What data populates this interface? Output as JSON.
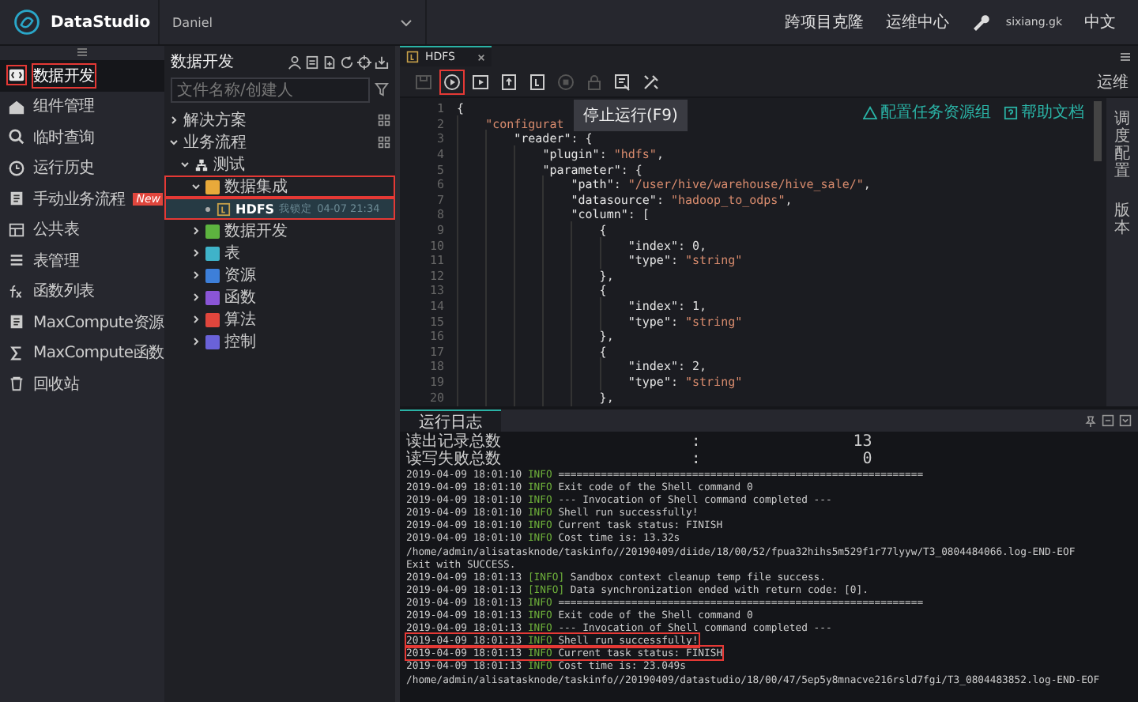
{
  "topbar": {
    "app_name": "DataStudio",
    "workspace": "Daniel",
    "links": [
      "跨项目克隆",
      "运维中心"
    ],
    "user": "sixiang.gk",
    "language": "中文"
  },
  "nav": [
    {
      "label": "数据开发",
      "selected": true,
      "annotated": true
    },
    {
      "label": "组件管理",
      "selected": false,
      "annotated": false
    },
    {
      "label": "临时查询",
      "selected": false,
      "annotated": false
    },
    {
      "label": "运行历史",
      "selected": false,
      "annotated": false
    },
    {
      "label": "手动业务流程",
      "selected": false,
      "annotated": false,
      "badge": "New"
    },
    {
      "label": "公共表",
      "selected": false,
      "annotated": false
    },
    {
      "label": "表管理",
      "selected": false,
      "annotated": false
    },
    {
      "label": "函数列表",
      "selected": false,
      "annotated": false
    },
    {
      "label": "MaxCompute资源",
      "selected": false,
      "annotated": false
    },
    {
      "label": "MaxCompute函数",
      "selected": false,
      "annotated": false
    },
    {
      "label": "回收站",
      "selected": false,
      "annotated": false
    }
  ],
  "tree_panel": {
    "title": "数据开发",
    "search": {
      "placeholder": "文件名称/创建人"
    },
    "items": [
      {
        "label": "解决方案",
        "kind": "section",
        "expanded": false
      },
      {
        "label": "业务流程",
        "kind": "section",
        "expanded": true,
        "children": [
          {
            "label": "测试",
            "kind": "flow",
            "expanded": true,
            "children": [
              {
                "label": "数据集成",
                "kind": "folder",
                "color": "#e8a93a",
                "expanded": true,
                "annotated": true,
                "children": [
                  {
                    "label": "HDFS",
                    "kind": "node",
                    "selected": true,
                    "annotated": true,
                    "lock": "我锁定",
                    "time": "04-07 21:34"
                  }
                ]
              },
              {
                "label": "数据开发",
                "kind": "folder",
                "color": "#5db33f",
                "expanded": false
              },
              {
                "label": "表",
                "kind": "folder",
                "color": "#3fb3c9",
                "expanded": false
              },
              {
                "label": "资源",
                "kind": "folder",
                "color": "#3d7fd9",
                "expanded": false
              },
              {
                "label": "函数",
                "kind": "folder",
                "color": "#8a55d6",
                "expanded": false
              },
              {
                "label": "算法",
                "kind": "folder",
                "color": "#e0463d",
                "expanded": false
              },
              {
                "label": "控制",
                "kind": "folder",
                "color": "#6a62d9",
                "expanded": false
              }
            ]
          }
        ]
      }
    ]
  },
  "editor": {
    "tabs": [
      {
        "label": "HDFS",
        "selected": true
      }
    ],
    "toolbar": [
      {
        "kind": "save",
        "disabled": true,
        "annotated": false
      },
      {
        "kind": "run",
        "disabled": false,
        "annotated": true
      },
      {
        "kind": "run-params",
        "disabled": false,
        "annotated": false
      },
      {
        "kind": "submit",
        "disabled": false,
        "annotated": false
      },
      {
        "kind": "publish",
        "disabled": false,
        "annotated": false
      },
      {
        "kind": "stop",
        "disabled": true,
        "annotated": false
      },
      {
        "kind": "lock",
        "disabled": true,
        "annotated": false
      },
      {
        "kind": "format",
        "disabled": false,
        "annotated": false
      },
      {
        "kind": "tool",
        "disabled": false,
        "annotated": false
      }
    ],
    "toolbar_right": "运维",
    "tooltip": "停止运行(F9)",
    "links": [
      "配置任务资源组",
      "帮助文档"
    ],
    "code": [
      {
        "number": "1",
        "text": "{"
      },
      {
        "number": "2",
        "text": "    \"configurat"
      },
      {
        "number": "3",
        "text": "        \"reader\": {"
      },
      {
        "number": "4",
        "text": "            \"plugin\": \"hdfs\","
      },
      {
        "number": "5",
        "text": "            \"parameter\": {"
      },
      {
        "number": "6",
        "text": "                \"path\": \"/user/hive/warehouse/hive_sale/\","
      },
      {
        "number": "7",
        "text": "                \"datasource\": \"hadoop_to_odps\","
      },
      {
        "number": "8",
        "text": "                \"column\": ["
      },
      {
        "number": "9",
        "text": "                    {"
      },
      {
        "number": "10",
        "text": "                        \"index\": 0,"
      },
      {
        "number": "11",
        "text": "                        \"type\": \"string\""
      },
      {
        "number": "12",
        "text": "                    },"
      },
      {
        "number": "13",
        "text": "                    {"
      },
      {
        "number": "14",
        "text": "                        \"index\": 1,"
      },
      {
        "number": "15",
        "text": "                        \"type\": \"string\""
      },
      {
        "number": "16",
        "text": "                    },"
      },
      {
        "number": "17",
        "text": "                    {"
      },
      {
        "number": "18",
        "text": "                        \"index\": 2,"
      },
      {
        "number": "19",
        "text": "                        \"type\": \"string\""
      },
      {
        "number": "20",
        "text": "                    },"
      }
    ],
    "side_tabs": [
      "调度配置",
      "版本"
    ]
  },
  "log": {
    "tab": "运行日志",
    "lines": [
      {
        "kind": "plain",
        "text": "读出记录总数                    :                13"
      },
      {
        "kind": "plain",
        "text": "读写失败总数                    :                 0"
      },
      {
        "kind": "log",
        "time": "2019-04-09 18:01:10",
        "level": "INFO",
        "message": "============================================================"
      },
      {
        "kind": "log",
        "time": "2019-04-09 18:01:10",
        "level": "INFO",
        "message": "Exit code of the Shell command 0"
      },
      {
        "kind": "log",
        "time": "2019-04-09 18:01:10",
        "level": "INFO",
        "message": "--- Invocation of Shell command completed ---"
      },
      {
        "kind": "log",
        "time": "2019-04-09 18:01:10",
        "level": "INFO",
        "message": "Shell run successfully!"
      },
      {
        "kind": "log",
        "time": "2019-04-09 18:01:10",
        "level": "INFO",
        "message": "Current task status: FINISH"
      },
      {
        "kind": "log",
        "time": "2019-04-09 18:01:10",
        "level": "INFO",
        "message": "Cost time is: 13.32s"
      },
      {
        "kind": "plain",
        "text": "/home/admin/alisatasknode/taskinfo//20190409/diide/18/00/52/fpua32hihs5m529f1r77lyyw/T3_0804484066.log-END-EOF"
      },
      {
        "kind": "plain",
        "text": "Exit with SUCCESS."
      },
      {
        "kind": "log",
        "time": "2019-04-09 18:01:13",
        "level": "[INFO]",
        "message": "Sandbox context cleanup temp file success."
      },
      {
        "kind": "log",
        "time": "2019-04-09 18:01:13",
        "level": "[INFO]",
        "message": "Data synchronization ended with return code: [0]."
      },
      {
        "kind": "log",
        "time": "2019-04-09 18:01:13",
        "level": "INFO",
        "message": "============================================================"
      },
      {
        "kind": "log",
        "time": "2019-04-09 18:01:13",
        "level": "INFO",
        "message": "Exit code of the Shell command 0"
      },
      {
        "kind": "log",
        "time": "2019-04-09 18:01:13",
        "level": "INFO",
        "message": "--- Invocation of Shell command completed ---"
      },
      {
        "kind": "log",
        "time": "2019-04-09 18:01:13",
        "level": "INFO",
        "message": "Shell run successfully!",
        "annotated": true
      },
      {
        "kind": "log",
        "time": "2019-04-09 18:01:13",
        "level": "INFO",
        "message": "Current task status: FINISH",
        "annotated": true
      },
      {
        "kind": "log",
        "time": "2019-04-09 18:01:13",
        "level": "INFO",
        "message": "Cost time is: 23.049s"
      },
      {
        "kind": "plain",
        "text": "/home/admin/alisatasknode/taskinfo//20190409/datastudio/18/00/47/5ep5y8mnacve216rsld7fgi/T3_0804483852.log-END-EOF"
      }
    ]
  }
}
